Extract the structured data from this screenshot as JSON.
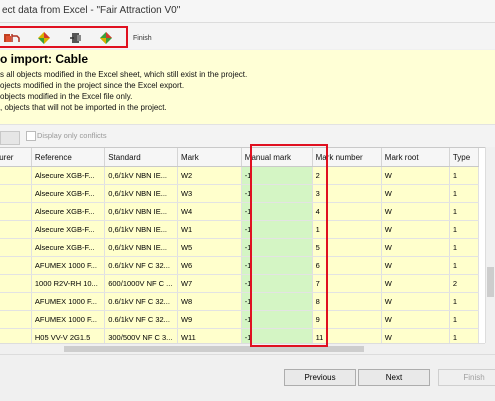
{
  "window": {
    "title": "ect data from Excel - \"Fair Attraction V0\""
  },
  "toolbar": {
    "finish_label": "Finish"
  },
  "banner": {
    "heading": "o import: Cable",
    "lines": [
      "s all objects modified in the Excel sheet, which still exist in the project.",
      "ojects modified in the project since the Excel export.",
      "objects modified in the Excel file only.",
      ", objects that will not be imported in the project."
    ]
  },
  "filter": {
    "display_conflicts_label": "Display only conflicts"
  },
  "grid": {
    "columns": [
      "turer",
      "Reference",
      "Standard",
      "Mark",
      "Manual mark",
      "Mark number",
      "Mark root",
      "Type"
    ],
    "rows": [
      [
        "",
        "Alsecure XGB-F...",
        "0,6/1kV NBN IE...",
        "W2",
        "-1",
        "2",
        "W",
        "1"
      ],
      [
        "",
        "Alsecure XGB-F...",
        "0,6/1kV NBN IE...",
        "W3",
        "-1",
        "3",
        "W",
        "1"
      ],
      [
        "",
        "Alsecure XGB-F...",
        "0,6/1kV NBN IE...",
        "W4",
        "-1",
        "4",
        "W",
        "1"
      ],
      [
        "",
        "Alsecure XGB-F...",
        "0,6/1kV NBN IE...",
        "W1",
        "-1",
        "1",
        "W",
        "1"
      ],
      [
        "",
        "Alsecure XGB-F...",
        "0,6/1kV NBN IE...",
        "W5",
        "-1",
        "5",
        "W",
        "1"
      ],
      [
        ".",
        "AFUMEX 1000 F...",
        "0.6/1kV NF C 32...",
        "W6",
        "-1",
        "6",
        "W",
        "1"
      ],
      [
        ".",
        "1000 R2V-RH 10...",
        "600/1000V NF C ...",
        "W7",
        "-1",
        "7",
        "W",
        "2"
      ],
      [
        ".",
        "AFUMEX 1000 F...",
        "0.6/1kV NF C 32...",
        "W8",
        "-1",
        "8",
        "W",
        "1"
      ],
      [
        ".",
        "AFUMEX 1000 F...",
        "0.6/1kV NF C 32...",
        "W9",
        "-1",
        "9",
        "W",
        "1"
      ],
      [
        "",
        "H05 VV-V 2G1.5",
        "300/500V NF C 3...",
        "W11",
        "-1",
        "11",
        "W",
        "1"
      ]
    ]
  },
  "footer": {
    "previous": "Previous",
    "next": "Next",
    "finish": "Finish"
  },
  "colors": {
    "highlight_border": "#e01020",
    "manual_mark_cell": "#d4f5c4",
    "banner": "#ffffd6",
    "modified_cell": "#ffffcc"
  }
}
